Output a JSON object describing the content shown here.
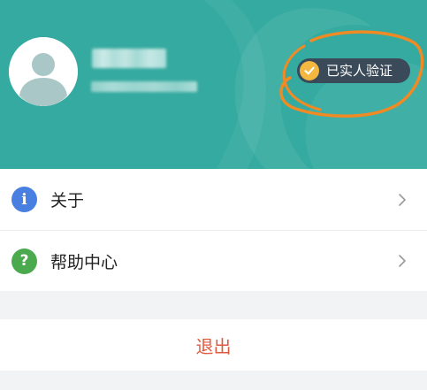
{
  "profile": {
    "verification_badge": "已实人验证",
    "avatar_icon": "default-user-avatar-icon",
    "badge_icon": "checkmark-icon"
  },
  "menu": {
    "items": [
      {
        "label": "关于",
        "icon": "info-icon"
      },
      {
        "label": "帮助中心",
        "icon": "question-icon"
      }
    ]
  },
  "actions": {
    "logout_label": "退出"
  },
  "theme": {
    "header_color": "#35aaa0",
    "badge_color": "#3a4a59",
    "badge_icon_color": "#f4b73f",
    "annotation_color": "#f08a24",
    "logout_color": "#e0593f"
  }
}
